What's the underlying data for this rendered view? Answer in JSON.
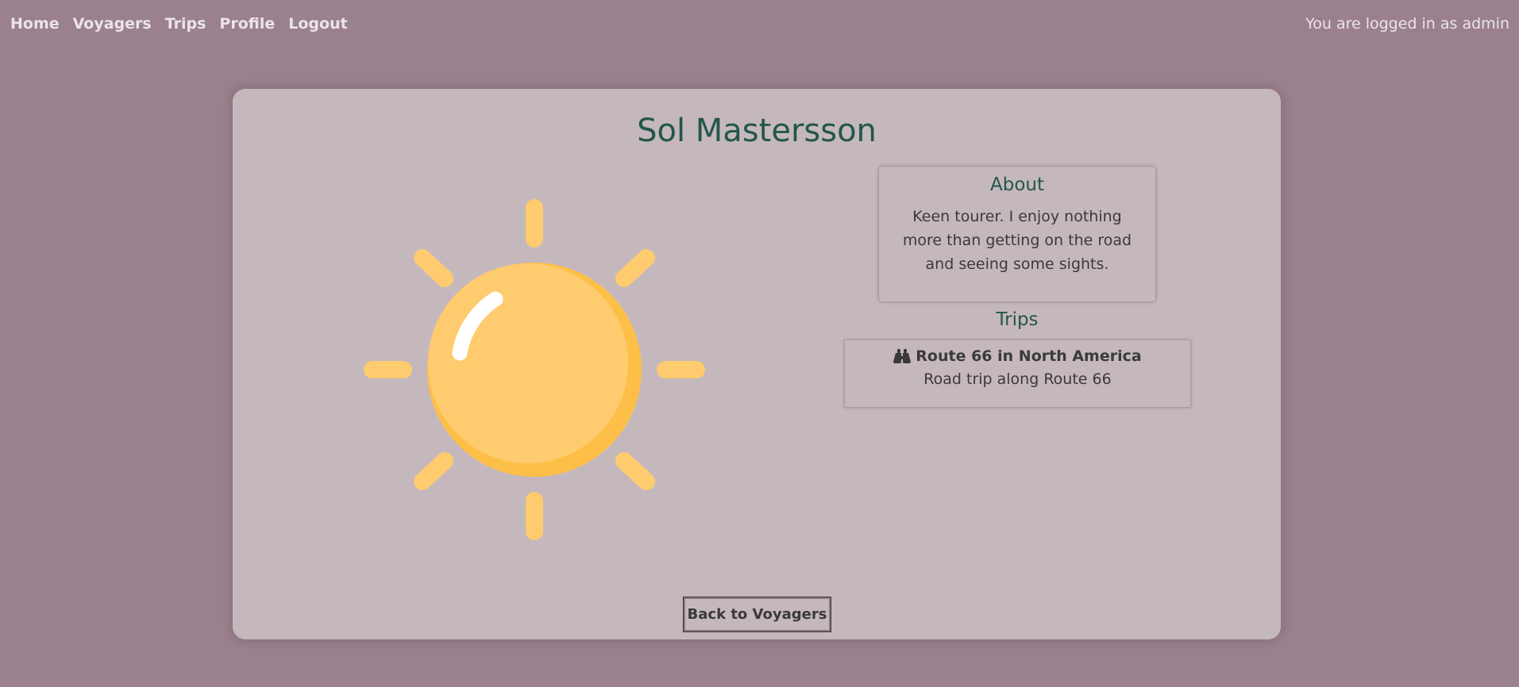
{
  "nav": {
    "links": [
      {
        "label": "Home"
      },
      {
        "label": "Voyagers"
      },
      {
        "label": "Trips"
      },
      {
        "label": "Profile"
      },
      {
        "label": "Logout"
      }
    ],
    "login_status": "You are logged in as admin"
  },
  "profile": {
    "name": "Sol Mastersson",
    "avatar_icon": "sun-icon",
    "about_heading": "About",
    "about_text": "Keen tourer. I enjoy nothing more than getting on the road and seeing some sights.",
    "trips_heading": "Trips",
    "trips": [
      {
        "icon": "binoculars-icon",
        "title": "Route 66 in North America",
        "description": "Road trip along Route 66"
      }
    ],
    "back_button": "Back to Voyagers"
  },
  "colors": {
    "background": "#9a818d",
    "card": "#c5b8bd",
    "heading": "#23564b",
    "sun": "#fecb6f",
    "sun_shade": "#fdbf47"
  }
}
